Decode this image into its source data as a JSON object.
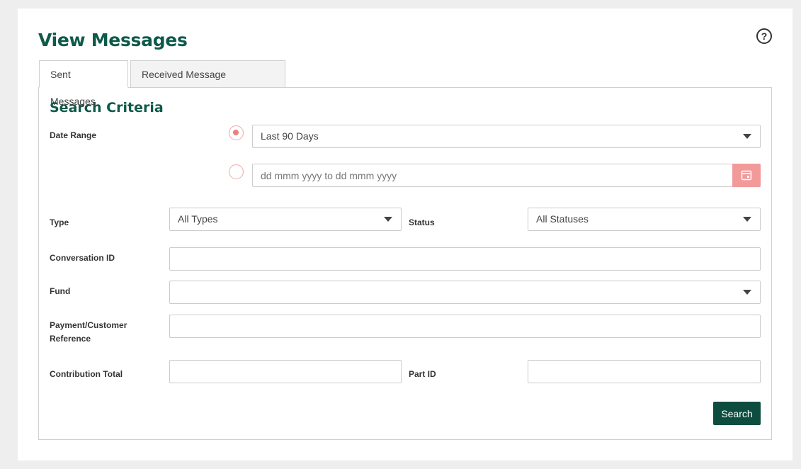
{
  "page": {
    "title": "View Messages",
    "help_icon": "?"
  },
  "tabs": [
    {
      "label": "Sent Messages",
      "active": true
    },
    {
      "label": "Received Message Responses",
      "active": false
    }
  ],
  "search": {
    "title": "Search Criteria",
    "date_range": {
      "label": "Date Range",
      "preset_value": "Last 90 Days",
      "custom_placeholder": "dd mmm yyyy to dd mmm yyyy",
      "selected": "preset"
    },
    "type": {
      "label": "Type",
      "value": "All Types"
    },
    "status": {
      "label": "Status",
      "value": "All Statuses"
    },
    "conversation_id": {
      "label": "Conversation ID",
      "value": ""
    },
    "fund": {
      "label": "Fund",
      "value": ""
    },
    "payment_reference": {
      "label": "Payment/Customer Reference",
      "value": ""
    },
    "contribution_total": {
      "label": "Contribution Total",
      "value": ""
    },
    "part_id": {
      "label": "Part ID",
      "value": ""
    },
    "submit_label": "Search"
  },
  "colors": {
    "brand": "#0d5a4a",
    "button": "#0d4d3f",
    "accent": "#f29a9a"
  },
  "icons": {
    "help": "help-icon",
    "calendar": "calendar-icon",
    "caret": "caret-down-icon"
  }
}
